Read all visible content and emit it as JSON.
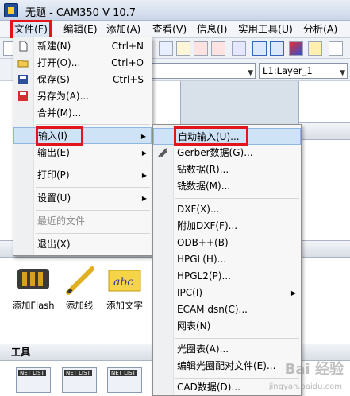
{
  "window": {
    "title": "无题 - CAM350 V 10.7"
  },
  "menubar": {
    "items": [
      "文件(F)",
      "编辑(E)",
      "添加(A)",
      "查看(V)",
      "信息(I)",
      "实用工具(U)",
      "分析(A)"
    ]
  },
  "layerbar": {
    "layer_select": "L1:Layer_1"
  },
  "file_menu": {
    "items": [
      {
        "label": "新建(N)",
        "shortcut": "Ctrl+N",
        "icon": "new-file-icon"
      },
      {
        "label": "打开(O)...",
        "shortcut": "Ctrl+O",
        "icon": "open-folder-icon"
      },
      {
        "label": "保存(S)",
        "shortcut": "Ctrl+S",
        "icon": "save-icon"
      },
      {
        "label": "另存为(A)...",
        "shortcut": "",
        "icon": "save-as-icon"
      },
      {
        "label": "合并(M)...",
        "shortcut": ""
      },
      {
        "label": "输入(I)",
        "submenu": true
      },
      {
        "label": "输出(E)",
        "submenu": true
      },
      {
        "label": "打印(P)",
        "submenu": true
      },
      {
        "label": "设置(U)",
        "submenu": true
      },
      {
        "label": "最近的文件",
        "disabled": true
      },
      {
        "label": "退出(X)"
      }
    ]
  },
  "import_submenu": {
    "items": [
      {
        "label": "自动输入(U)..."
      },
      {
        "label": "Gerber数据(G)...",
        "icon": "gerber-icon"
      },
      {
        "label": "钻数据(R)..."
      },
      {
        "label": "铣数据(M)..."
      },
      {
        "label": "DXF(X)..."
      },
      {
        "label": "附加DXF(F)..."
      },
      {
        "label": "ODB++(B)"
      },
      {
        "label": "HPGL(H)..."
      },
      {
        "label": "HPGL2(P)..."
      },
      {
        "label": "IPC(I)",
        "submenu": true
      },
      {
        "label": "ECAM dsn(C)..."
      },
      {
        "label": "网表(N)"
      },
      {
        "label": "光圈表(A)..."
      },
      {
        "label": "编辑光圈配对文件(E)..."
      },
      {
        "label": "CAD数据(D)..."
      }
    ]
  },
  "left_panel": {
    "tools_add": [
      {
        "label": "添加Flash",
        "icon": "flash-pads-icon"
      },
      {
        "label": "添加线",
        "icon": "pencil-icon"
      },
      {
        "label": "添加文字",
        "icon": "text-abc-icon"
      }
    ],
    "tools_section_label": "工具",
    "tool_badges": [
      "NET LIST",
      "NET LIST",
      "NET LIST"
    ]
  },
  "watermark": {
    "text": "Bai 经验",
    "sub": "jingyan.baidu.com"
  },
  "colors": {
    "highlight_red": "#e4141b",
    "menu_hover": "#cfe3f7"
  }
}
